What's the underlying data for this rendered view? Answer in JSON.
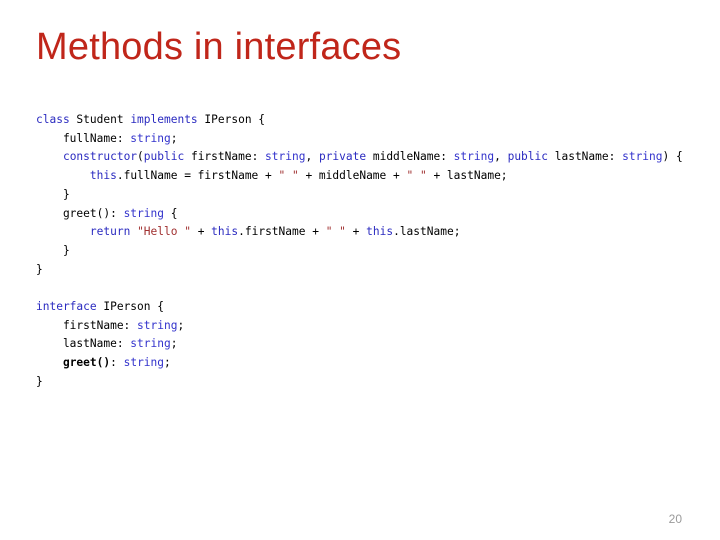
{
  "slide": {
    "title": "Methods in interfaces",
    "title_color": "#C0261A",
    "background_color": "#FFFFFF",
    "page_number": "20"
  },
  "palette": {
    "keyword": "#2B2BC0",
    "type": "#3333CC",
    "string": "#A03030",
    "plain": "#000000",
    "page_number": "#9A9A9A"
  },
  "code": {
    "language": "typescript",
    "lines": [
      {
        "id": "line-1",
        "text": "class Student implements IPerson {",
        "tokens": [
          {
            "t": "class",
            "c": "kw"
          },
          {
            "t": " Student ",
            "c": "plain"
          },
          {
            "t": "implements",
            "c": "kw"
          },
          {
            "t": " IPerson {",
            "c": "plain"
          }
        ]
      },
      {
        "id": "line-2",
        "text": "    fullName: string;",
        "tokens": [
          {
            "t": "    fullName: ",
            "c": "plain"
          },
          {
            "t": "string",
            "c": "type"
          },
          {
            "t": ";",
            "c": "plain"
          }
        ]
      },
      {
        "id": "line-3",
        "text": "    constructor(public firstName: string, private middleName: string, public lastName: string) {",
        "tokens": [
          {
            "t": "    ",
            "c": "plain"
          },
          {
            "t": "constructor",
            "c": "kw"
          },
          {
            "t": "(",
            "c": "plain"
          },
          {
            "t": "public",
            "c": "kw"
          },
          {
            "t": " firstName: ",
            "c": "plain"
          },
          {
            "t": "string",
            "c": "type"
          },
          {
            "t": ", ",
            "c": "plain"
          },
          {
            "t": "private",
            "c": "kw"
          },
          {
            "t": " middleName: ",
            "c": "plain"
          },
          {
            "t": "string",
            "c": "type"
          },
          {
            "t": ", ",
            "c": "plain"
          },
          {
            "t": "public",
            "c": "kw"
          },
          {
            "t": " lastName: ",
            "c": "plain"
          },
          {
            "t": "string",
            "c": "type"
          },
          {
            "t": ") {",
            "c": "plain"
          }
        ]
      },
      {
        "id": "line-4",
        "text": "        this.fullName = firstName + \" \" + middleName + \" \" + lastName;",
        "tokens": [
          {
            "t": "        ",
            "c": "plain"
          },
          {
            "t": "this",
            "c": "kw"
          },
          {
            "t": ".fullName = firstName + ",
            "c": "plain"
          },
          {
            "t": "\" \"",
            "c": "str"
          },
          {
            "t": " + middleName + ",
            "c": "plain"
          },
          {
            "t": "\" \"",
            "c": "str"
          },
          {
            "t": " + lastName;",
            "c": "plain"
          }
        ]
      },
      {
        "id": "line-5",
        "text": "    }",
        "tokens": [
          {
            "t": "    }",
            "c": "plain"
          }
        ]
      },
      {
        "id": "line-6",
        "text": "    greet(): string {",
        "tokens": [
          {
            "t": "    greet(): ",
            "c": "plain"
          },
          {
            "t": "string",
            "c": "type"
          },
          {
            "t": " {",
            "c": "plain"
          }
        ]
      },
      {
        "id": "line-7",
        "text": "        return \"Hello \" + this.firstName + \" \" + this.lastName;",
        "tokens": [
          {
            "t": "        ",
            "c": "plain"
          },
          {
            "t": "return",
            "c": "kw"
          },
          {
            "t": " ",
            "c": "plain"
          },
          {
            "t": "\"Hello \"",
            "c": "str"
          },
          {
            "t": " + ",
            "c": "plain"
          },
          {
            "t": "this",
            "c": "kw"
          },
          {
            "t": ".firstName + ",
            "c": "plain"
          },
          {
            "t": "\" \"",
            "c": "str"
          },
          {
            "t": " + ",
            "c": "plain"
          },
          {
            "t": "this",
            "c": "kw"
          },
          {
            "t": ".lastName;",
            "c": "plain"
          }
        ]
      },
      {
        "id": "line-8",
        "text": "    }",
        "tokens": [
          {
            "t": "    }",
            "c": "plain"
          }
        ]
      },
      {
        "id": "line-9",
        "text": "}",
        "tokens": [
          {
            "t": "}",
            "c": "plain"
          }
        ]
      },
      {
        "id": "line-10",
        "text": "",
        "tokens": []
      },
      {
        "id": "line-11",
        "text": "interface IPerson {",
        "tokens": [
          {
            "t": "interface",
            "c": "kw"
          },
          {
            "t": " IPerson {",
            "c": "plain"
          }
        ]
      },
      {
        "id": "line-12",
        "text": "    firstName: string;",
        "tokens": [
          {
            "t": "    firstName: ",
            "c": "plain"
          },
          {
            "t": "string",
            "c": "type"
          },
          {
            "t": ";",
            "c": "plain"
          }
        ]
      },
      {
        "id": "line-13",
        "text": "    lastName: string;",
        "tokens": [
          {
            "t": "    lastName: ",
            "c": "plain"
          },
          {
            "t": "string",
            "c": "type"
          },
          {
            "t": ";",
            "c": "plain"
          }
        ]
      },
      {
        "id": "line-14",
        "text": "    greet(): string;",
        "tokens": [
          {
            "t": "    ",
            "c": "plain"
          },
          {
            "t": "greet()",
            "c": "bold"
          },
          {
            "t": ": ",
            "c": "plain"
          },
          {
            "t": "string",
            "c": "type"
          },
          {
            "t": ";",
            "c": "plain"
          }
        ]
      },
      {
        "id": "line-15",
        "text": "}",
        "tokens": [
          {
            "t": "}",
            "c": "plain"
          }
        ]
      }
    ]
  }
}
